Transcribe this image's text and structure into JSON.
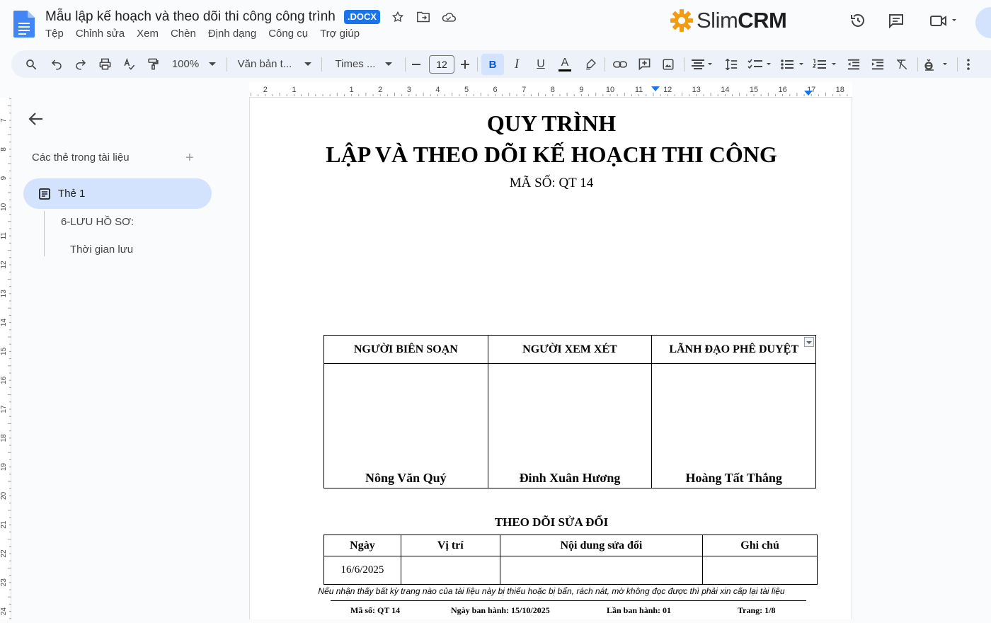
{
  "header": {
    "doc_title": "Mẫu lập kế hoạch và theo dõi thi công công trình",
    "file_badge": ".DOCX",
    "menu": [
      "Tệp",
      "Chỉnh sửa",
      "Xem",
      "Chèn",
      "Định dạng",
      "Công cụ",
      "Trợ giúp"
    ],
    "brand_light": "Slim",
    "brand_bold": "CRM",
    "brand_color": "#f39c12"
  },
  "toolbar": {
    "zoom": "100%",
    "style": "Văn bản t...",
    "font": "Times ...",
    "font_size": "12",
    "bold": "B",
    "italic": "I",
    "underline": "U",
    "text_color": "A"
  },
  "ruler": {
    "h_labels": [
      "2",
      "1",
      "1",
      "2",
      "3",
      "4",
      "5",
      "6",
      "7",
      "8",
      "9",
      "10",
      "11",
      "12",
      "13",
      "14",
      "15",
      "16",
      "17",
      "18"
    ],
    "v_labels": [
      "7",
      "8",
      "9",
      "10",
      "11",
      "12",
      "13",
      "14",
      "15",
      "16",
      "17",
      "18",
      "19",
      "20",
      "21",
      "22",
      "23",
      "24"
    ]
  },
  "sidebar": {
    "tabs_title": "Các thẻ trong tài liệu",
    "active_tab": "Thẻ 1",
    "outline": [
      "6-LƯU HỒ SƠ:",
      "Thời gian lưu"
    ]
  },
  "document": {
    "title1": "QUY TRÌNH",
    "title2": "LẬP VÀ THEO DÕI KẾ HOẠCH THI CÔNG",
    "code": "MÃ SỐ: QT 14",
    "sign_headers": [
      "NGƯỜI BIÊN SOẠN",
      "NGƯỜI XEM XÉT",
      "LÃNH ĐẠO PHÊ DUYỆT"
    ],
    "sign_names": [
      "Nông Văn Quý",
      "Đinh Xuân Hương",
      "Hoàng Tất Thắng"
    ],
    "rev_title": "THEO DÕI SỬA ĐỔI",
    "rev_headers": [
      "Ngày",
      "Vị trí",
      "Nội dung sửa đổi",
      "Ghi chú"
    ],
    "rev_rows": [
      [
        "16/6/2025",
        "",
        "",
        ""
      ]
    ],
    "footer_note": "Nếu nhận thấy bất kỳ trang nào của tài liệu này bị thiếu hoặc bị bẩn, rách nát, mờ không đọc được thì phải xin cấp lại tài liệu",
    "footer_code": "Mã số: QT 14",
    "footer_date": "Ngày ban hành: 15/10/2025",
    "footer_issue": "Lần ban hành: 01",
    "footer_page": "Trang:   1/8"
  }
}
